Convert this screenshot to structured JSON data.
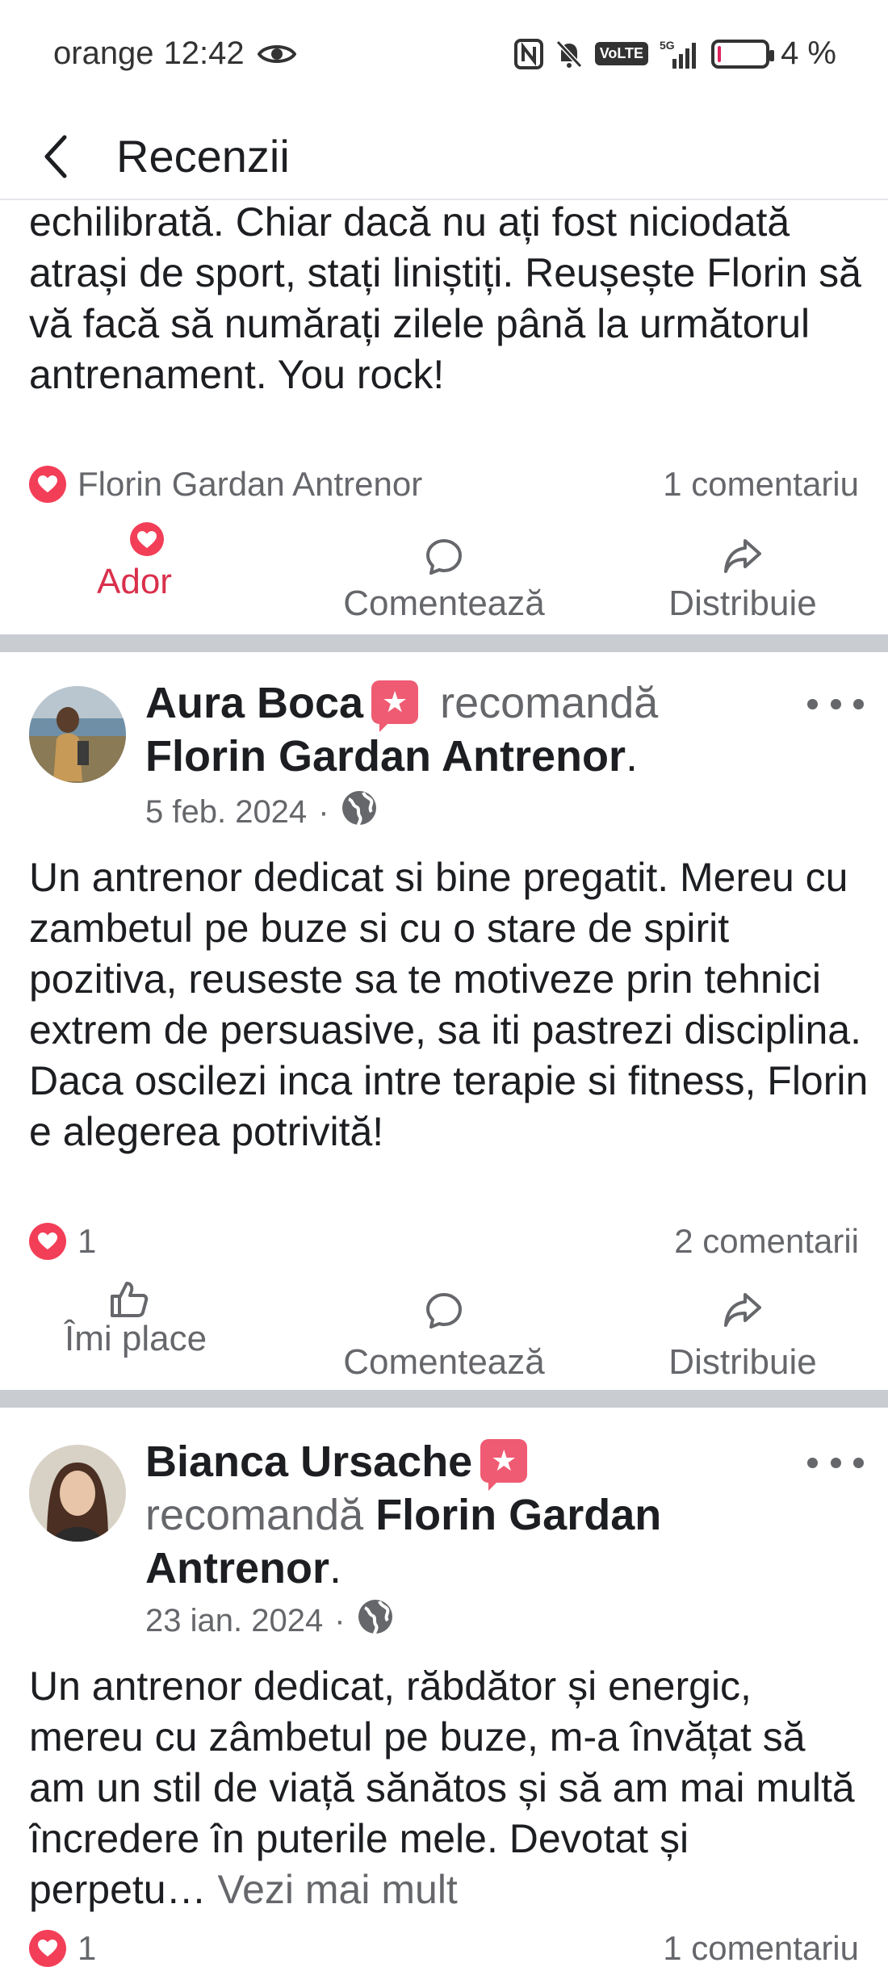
{
  "status_bar": {
    "carrier": "orange",
    "time": "12:42",
    "network": "5G",
    "volte": "VoLTE",
    "battery": "4 %",
    "battery_level": 0.04
  },
  "header": {
    "title": "Recenzii"
  },
  "top_post": {
    "text": "echilibrată. Chiar dacă nu ați fost niciodată atrași de sport, stați liniștiți. Reușește Florin să vă facă să numărați zilele până la următorul antrenament. You rock!",
    "reacted_by": "Florin Gardan Antrenor",
    "comments": "1 comentariu",
    "actions": {
      "love": "Ador",
      "comment": "Comentează",
      "share": "Distribuie"
    }
  },
  "posts": [
    {
      "author": "Aura Boca",
      "verb": "recomandă",
      "page": "Florin Gardan Antrenor",
      "date": "5 feb. 2024",
      "text": "Un antrenor dedicat si bine pregatit. Mereu cu zambetul pe buze si cu o stare de spirit pozitiva, reuseste sa te motiveze prin tehnici extrem de persuasive, sa iti pastrezi disciplina. Daca oscilezi inca intre terapie si fitness, Florin e alegerea potrivită!",
      "reactions": "1",
      "comments": "2 comentarii",
      "actions": {
        "like": "Îmi place",
        "comment": "Comentează",
        "share": "Distribuie"
      }
    },
    {
      "author": "Bianca Ursache",
      "verb": "recomandă",
      "page": "Florin Gardan Antrenor",
      "date": "23 ian. 2024",
      "text": "Un antrenor dedicat, răbdător și energic, mereu cu zâmbetul pe buze, m-a învățat să am un stil de viață sănătos și să am mai multă încredere în puterile mele. Devotat și perpetu…",
      "see_more": "Vezi mai mult",
      "reactions": "1",
      "comments": "1 comentariu"
    }
  ],
  "colors": {
    "love": "#f33e58",
    "recommend_badge": "#ef5b72",
    "muted_text": "#65676b",
    "divider": "#c9ccd1"
  },
  "icons": [
    "eye-icon",
    "nfc-icon",
    "mute-icon",
    "signal-icon",
    "battery-icon",
    "back-arrow-icon",
    "heart-icon",
    "comment-icon",
    "share-icon",
    "thumbs-up-icon",
    "globe-icon",
    "more-icon",
    "recommend-icon"
  ]
}
